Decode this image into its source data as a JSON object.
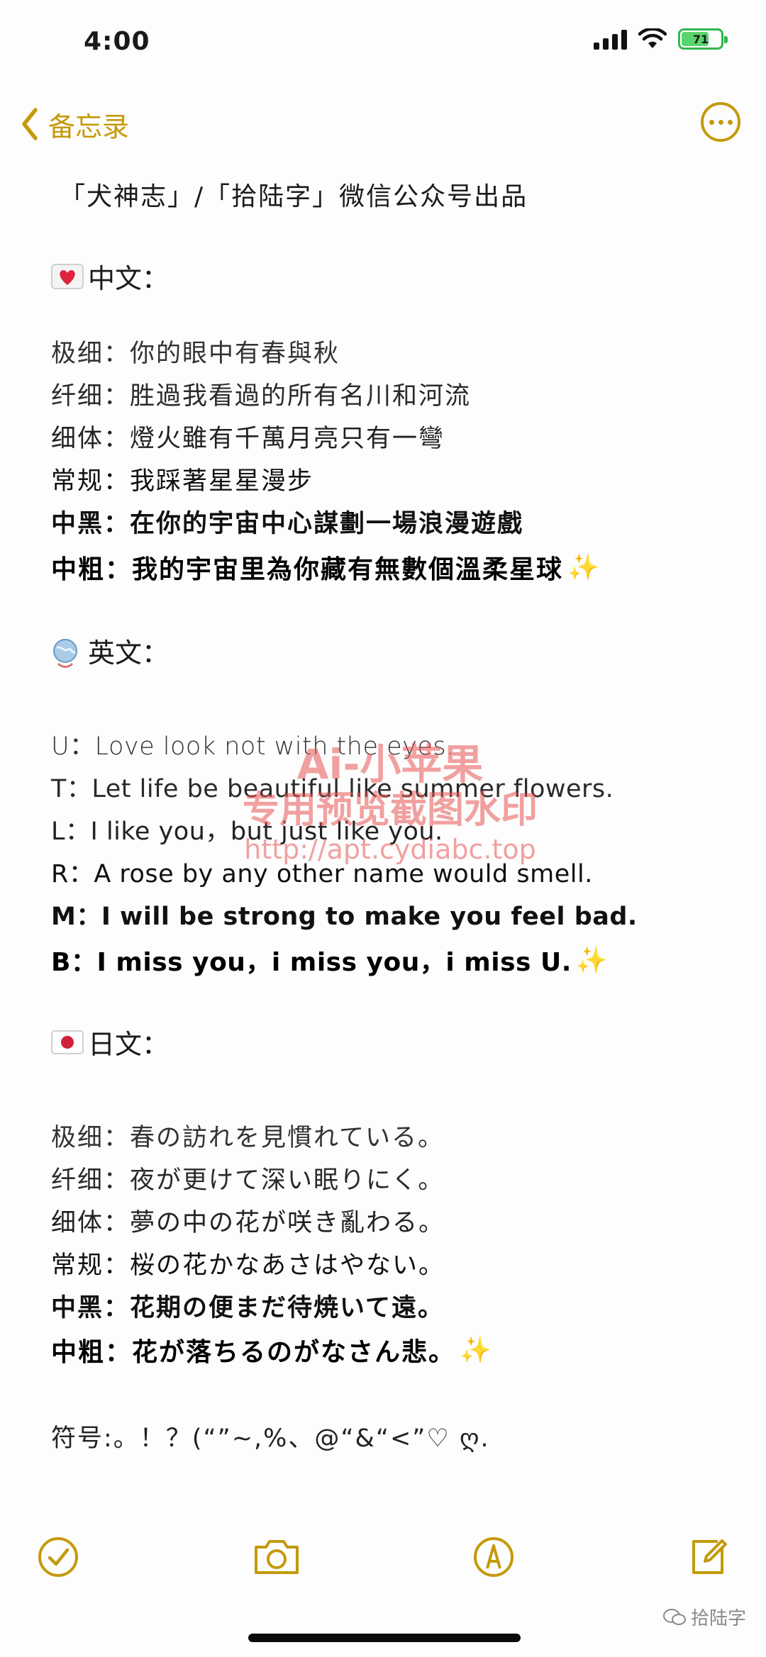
{
  "status": {
    "time": "4:00",
    "battery": "71",
    "battery_level": 0.71
  },
  "nav": {
    "back_label": "备忘录"
  },
  "note": {
    "title": "「犬神志」/「拾陆字」微信公众号出品",
    "chinese_head": "中文：",
    "chinese": [
      "极细：你的眼中有春與秋",
      "纤细：胜過我看過的所有名川和河流",
      "细体：燈火雖有千萬月亮只有一彎",
      "常规：我踩著星星漫步",
      "中黑：在你的宇宙中心謀劃一場浪漫遊戲",
      "中粗：我的宇宙里為你藏有無數個溫柔星球"
    ],
    "english_head": "英文：",
    "english": [
      "U：Love look not with the eyes.",
      "T：Let life be beautiful like summer flowers.",
      "L：I like you，but just like you.",
      "R：A rose by any other name would smell.",
      "M：I will be strong to make you feel bad.",
      "B：I miss you，i miss you，i miss U."
    ],
    "japanese_head": "日文：",
    "japanese": [
      "极细：春の訪れを見慣れている。",
      "纤细：夜が更けて深い眠りにく。",
      "细体：夢の中の花が咲き亂わる。",
      "常规：桜の花かなあさはやない。",
      "中黑：花期の便まだ待焼いて遠。",
      "中粗：花が落ちるのがなさん悲。"
    ],
    "symbols": "符号:。！？(“”~,%、@“&“<”♡ ღ."
  },
  "watermark": {
    "line1": "Ai-小苹果",
    "line2": "专用预览截图水印",
    "line3": "http://apt.cydiabc.top"
  },
  "wechat": {
    "label": "拾陆字"
  },
  "colors": {
    "accent": "#c49a0c",
    "watermark": "#e85454",
    "battery": "#5ad56d"
  }
}
